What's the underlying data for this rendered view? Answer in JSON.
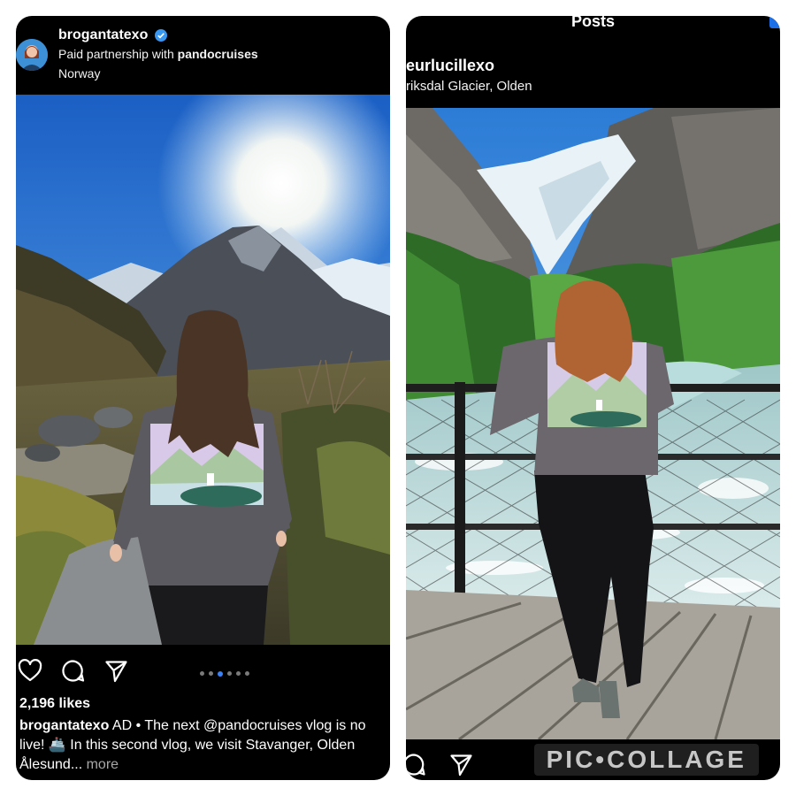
{
  "left_post": {
    "username": "brogantatexo",
    "partnership_prefix": "Paid partnership with ",
    "partner": "pandocruises",
    "location": "Norway",
    "likes": "2,196 likes",
    "caption_username": "brogantatexo",
    "caption_line1": " AD • The next @pandocruises vlog is no",
    "caption_line2": "live! 🚢 In this second vlog, we visit Stavanger, Olden",
    "caption_line3": "Ålesund...",
    "more_label": " more",
    "carousel_dots": 6,
    "carousel_active_index": 2
  },
  "right_post": {
    "page_title": "Posts",
    "username": "eurlucillexo",
    "location": "riksdal Glacier, Olden"
  },
  "watermark": "PIC•COLLAGE",
  "icons": [
    "heart-icon",
    "comment-icon",
    "share-icon",
    "verified-badge-icon",
    "avatar"
  ],
  "colors": {
    "background": "#000000",
    "verified": "#3897f0",
    "carousel_active": "#3b82f6",
    "muted": "#a8a8a8"
  }
}
